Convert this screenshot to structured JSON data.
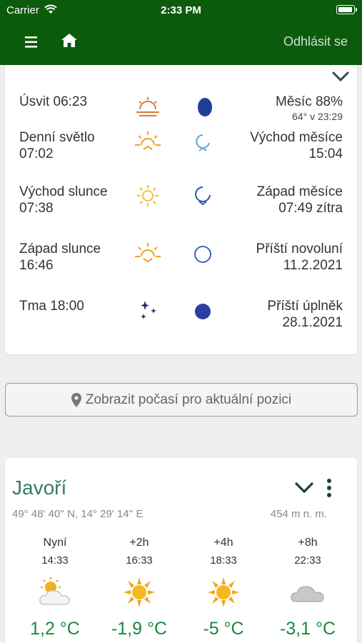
{
  "status_bar": {
    "carrier": "Carrier",
    "time": "2:33 PM"
  },
  "nav": {
    "logout_label": "Odhlásit se"
  },
  "sun_moon": [
    {
      "left": "Úsvit 06:23",
      "sun_icon": "dawn-icon",
      "moon_icon": "moon-phase-icon",
      "right": "Měsíc 88%",
      "right_small": "64° v 23:29"
    },
    {
      "left": "Denní světlo 07:02",
      "sun_icon": "daylight-icon",
      "moon_icon": "moonrise-icon",
      "right": "Východ měsíce 15:04"
    },
    {
      "left": "Východ slunce 07:38",
      "sun_icon": "sunrise-icon",
      "moon_icon": "moonset-icon",
      "right": "Západ měsíce 07:49 zítra"
    },
    {
      "left": "Západ slunce 16:46",
      "sun_icon": "sunset-icon",
      "moon_icon": "new-moon-icon",
      "right": "Příští novoluní 11.2.2021"
    },
    {
      "left": "Tma 18:00",
      "sun_icon": "stars-icon",
      "moon_icon": "full-moon-icon",
      "right": "Příští úplněk 28.1.2021"
    }
  ],
  "position_button": {
    "label": "Zobrazit počasí pro aktuální pozici"
  },
  "location": {
    "name": "Javoří",
    "coords": "49° 48' 40'' N, 14° 29' 14'' E",
    "altitude": "454 m n. m.",
    "forecast": [
      {
        "label": "Nyní",
        "time": "14:33",
        "icon": "partly-sunny-icon",
        "temp": "1,2 °C"
      },
      {
        "label": "+2h",
        "time": "16:33",
        "icon": "sun-icon",
        "temp": "-1,9 °C"
      },
      {
        "label": "+4h",
        "time": "18:33",
        "icon": "sun-icon",
        "temp": "-5 °C"
      },
      {
        "label": "+8h",
        "time": "22:33",
        "icon": "cloud-icon",
        "temp": "-3,1 °C"
      }
    ]
  },
  "colors": {
    "header": "#0c5a0c",
    "accent": "#3a7a64",
    "temp": "#1a8a3a",
    "moon": "#1e3e9a",
    "sun": "#f0a020"
  }
}
